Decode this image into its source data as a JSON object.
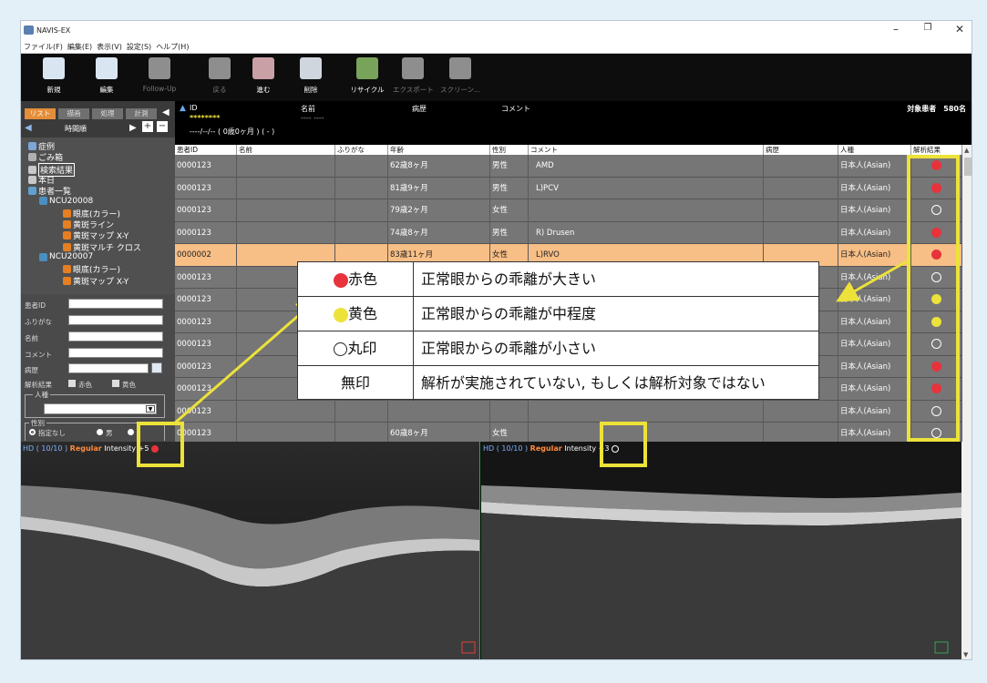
{
  "window": {
    "title": "NAVIS-EX"
  },
  "menu": [
    "ファイル(F)",
    "編集(E)",
    "表示(V)",
    "設定(S)",
    "ヘルプ(H)"
  ],
  "toolbar": [
    {
      "label": "新規",
      "color": "#d9e6f2",
      "enabled": true
    },
    {
      "label": "編集",
      "color": "#d9e6f2",
      "enabled": true
    },
    {
      "label": "Follow-Up",
      "color": "#8e8e8e",
      "enabled": false
    },
    {
      "label": "戻る",
      "color": "#8e8e8e",
      "enabled": false
    },
    {
      "label": "進む",
      "color": "#c9a0a6",
      "enabled": true
    },
    {
      "label": "削除",
      "color": "#cfd6dd",
      "enabled": true
    },
    {
      "label": "リサイクル",
      "color": "#78a35b",
      "enabled": true
    },
    {
      "label": "エクスポート",
      "color": "#8e8e8e",
      "enabled": false
    },
    {
      "label": "スクリーン...",
      "color": "#8e8e8e",
      "enabled": false
    }
  ],
  "left_tabs": [
    "リスト",
    "描画",
    "処理",
    "計測"
  ],
  "sort_label": "時間順",
  "tree": [
    {
      "label": "症例",
      "icon": "#7ea6d8",
      "level": 0
    },
    {
      "label": "ごみ箱",
      "icon": "#b0b0b0",
      "level": 0
    },
    {
      "label": "検索結果",
      "icon": "#c8c8c8",
      "level": 0
    },
    {
      "label": "本日",
      "icon": "#c8c8c8",
      "level": 0
    },
    {
      "label": "患者一覧",
      "icon": "#5fa0d0",
      "level": 0
    },
    {
      "label": "NCU20008",
      "icon": "#4a8fc0",
      "level": 1
    },
    {
      "label": "眼底(カラー)",
      "icon": "#e67e22",
      "level": 2
    },
    {
      "label": "黄斑ライン",
      "icon": "#e67e22",
      "level": 2
    },
    {
      "label": "黄斑マップ X-Y",
      "icon": "#e67e22",
      "level": 2
    },
    {
      "label": "黄斑マルチ クロス",
      "icon": "#e67e22",
      "level": 2
    },
    {
      "label": "NCU20007",
      "icon": "#4a8fc0",
      "level": 1
    },
    {
      "label": "眼底(カラー)",
      "icon": "#e67e22",
      "level": 2
    },
    {
      "label": "黄斑マップ X-Y",
      "icon": "#e67e22",
      "level": 2
    }
  ],
  "form": {
    "patient_id": "患者ID",
    "furigana": "ふりがな",
    "name": "名前",
    "comment": "コメント",
    "history": "病歴",
    "result_label": "解析結果",
    "red": "赤色",
    "yellow": "黄色",
    "race": "人種",
    "sex": "性別",
    "sex_none": "指定なし",
    "sex_male": "男"
  },
  "info": {
    "id_label": "ID",
    "name_label": "名前",
    "history_label": "病歴",
    "comment_label": "コメント",
    "id_value": "********",
    "name_value": "---- ----",
    "dob_value": "----/--/-- ( 0歳0ヶ月 ) ( - )",
    "count_label": "対象患者　580名"
  },
  "grid": {
    "headers": [
      "患者ID",
      "名前",
      "ふりがな",
      "年齢",
      "性別",
      "コメント",
      "病歴",
      "人種",
      "解析結果"
    ],
    "rows": [
      {
        "id": "0000123",
        "age": "62歳8ヶ月",
        "sex": "男性",
        "comment": "AMD",
        "race": "日本人(Asian)",
        "result": "red",
        "sel": false
      },
      {
        "id": "0000123",
        "age": "81歳9ヶ月",
        "sex": "男性",
        "comment": "L)PCV",
        "race": "日本人(Asian)",
        "result": "red",
        "sel": false
      },
      {
        "id": "0000123",
        "age": "79歳2ヶ月",
        "sex": "女性",
        "comment": "",
        "race": "日本人(Asian)",
        "result": "circle",
        "sel": false
      },
      {
        "id": "0000123",
        "age": "74歳8ヶ月",
        "sex": "男性",
        "comment": "R) Drusen",
        "race": "日本人(Asian)",
        "result": "red",
        "sel": false
      },
      {
        "id": "0000002",
        "age": "83歳11ヶ月",
        "sex": "女性",
        "comment": "L)RVO",
        "race": "日本人(Asian)",
        "result": "red",
        "sel": true
      },
      {
        "id": "0000123",
        "age": "",
        "sex": "",
        "comment": "",
        "race": "日本人(Asian)",
        "result": "circle",
        "sel": false
      },
      {
        "id": "0000123",
        "age": "",
        "sex": "",
        "comment": "",
        "race": "日本人(Asian)",
        "result": "yellow",
        "sel": false
      },
      {
        "id": "0000123",
        "age": "",
        "sex": "",
        "comment": "",
        "race": "日本人(Asian)",
        "result": "yellow",
        "sel": false
      },
      {
        "id": "0000123",
        "age": "",
        "sex": "",
        "comment": "",
        "race": "日本人(Asian)",
        "result": "circle",
        "sel": false
      },
      {
        "id": "0000123",
        "age": "",
        "sex": "",
        "comment": "",
        "race": "日本人(Asian)",
        "result": "red",
        "sel": false
      },
      {
        "id": "0000123",
        "age": "",
        "sex": "",
        "comment": "",
        "race": "日本人(Asian)",
        "result": "red",
        "sel": false
      },
      {
        "id": "0000123",
        "age": "",
        "sex": "",
        "comment": "",
        "race": "日本人(Asian)",
        "result": "circle",
        "sel": false
      },
      {
        "id": "0000123",
        "age": "60歳8ヶ月",
        "sex": "女性",
        "comment": "",
        "race": "日本人(Asian)",
        "result": "circle",
        "sel": false
      }
    ]
  },
  "oct": {
    "left": {
      "quality": "HD ( 10/10 )",
      "mode": "Regular",
      "intensity": "Intensity +5",
      "result": "red"
    },
    "right": {
      "quality": "HD ( 10/10 )",
      "mode": "Regular",
      "intensity": "Intensity +3",
      "result": "circle"
    }
  },
  "legend": [
    {
      "key": "赤色",
      "symbol": "red",
      "text": "正常眼からの乖離が大きい"
    },
    {
      "key": "黄色",
      "symbol": "yellow",
      "text": "正常眼からの乖離が中程度"
    },
    {
      "key": "丸印",
      "symbol": "circle",
      "text": "正常眼からの乖離が小さい"
    },
    {
      "key": "無印",
      "symbol": "none",
      "text": "解析が実施されていない, もしくは解析対象ではない"
    }
  ],
  "colors": {
    "red": "#e8323c",
    "yellow": "#ece23a",
    "highlight": "#ece23a",
    "selected_row": "#f7be86"
  }
}
